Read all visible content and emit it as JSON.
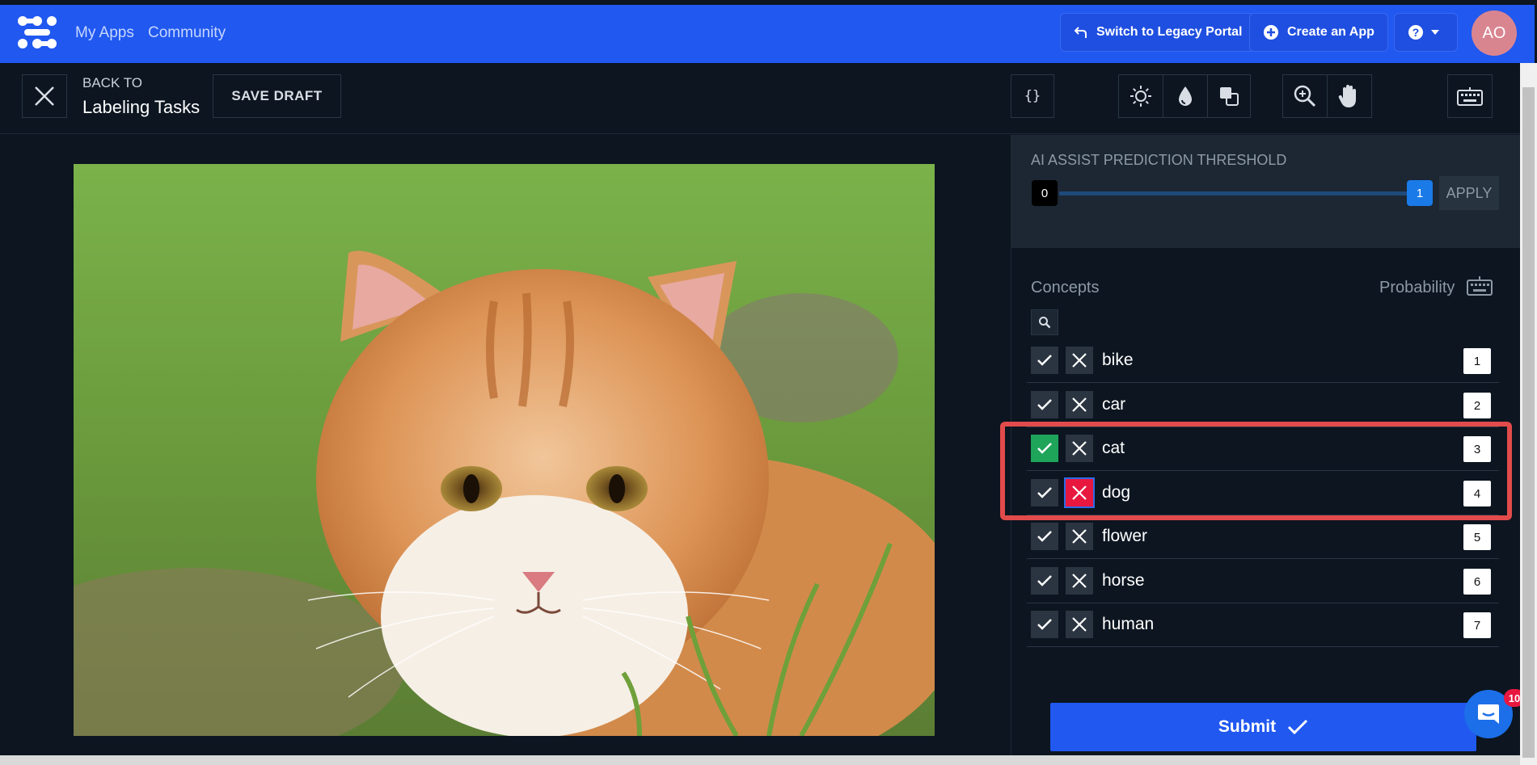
{
  "nav": {
    "links": [
      "My Apps",
      "Community"
    ],
    "legacy_label": "Switch to Legacy Portal",
    "create_label": "Create an App",
    "avatar_initials": "AO"
  },
  "toolbar": {
    "back_label": "BACK TO",
    "back_title": "Labeling Tasks",
    "save_draft": "SAVE DRAFT",
    "json_label": "{}"
  },
  "ai_assist": {
    "title": "AI ASSIST PREDICTION THRESHOLD",
    "min": "0",
    "max": "1",
    "apply": "APPLY"
  },
  "concepts": {
    "header": "Concepts",
    "probability_header": "Probability",
    "items": [
      {
        "name": "bike",
        "key": "1",
        "accepted": false,
        "rejected": false
      },
      {
        "name": "car",
        "key": "2",
        "accepted": false,
        "rejected": false
      },
      {
        "name": "cat",
        "key": "3",
        "accepted": true,
        "rejected": false
      },
      {
        "name": "dog",
        "key": "4",
        "accepted": false,
        "rejected": true
      },
      {
        "name": "flower",
        "key": "5",
        "accepted": false,
        "rejected": false
      },
      {
        "name": "horse",
        "key": "6",
        "accepted": false,
        "rejected": false
      },
      {
        "name": "human",
        "key": "7",
        "accepted": false,
        "rejected": false
      }
    ]
  },
  "submit_label": "Submit",
  "chat_badge": "10",
  "colors": {
    "brand": "#2058f0",
    "accept": "#1fa55a",
    "reject": "#e8173f",
    "highlight": "#e24b4b"
  }
}
